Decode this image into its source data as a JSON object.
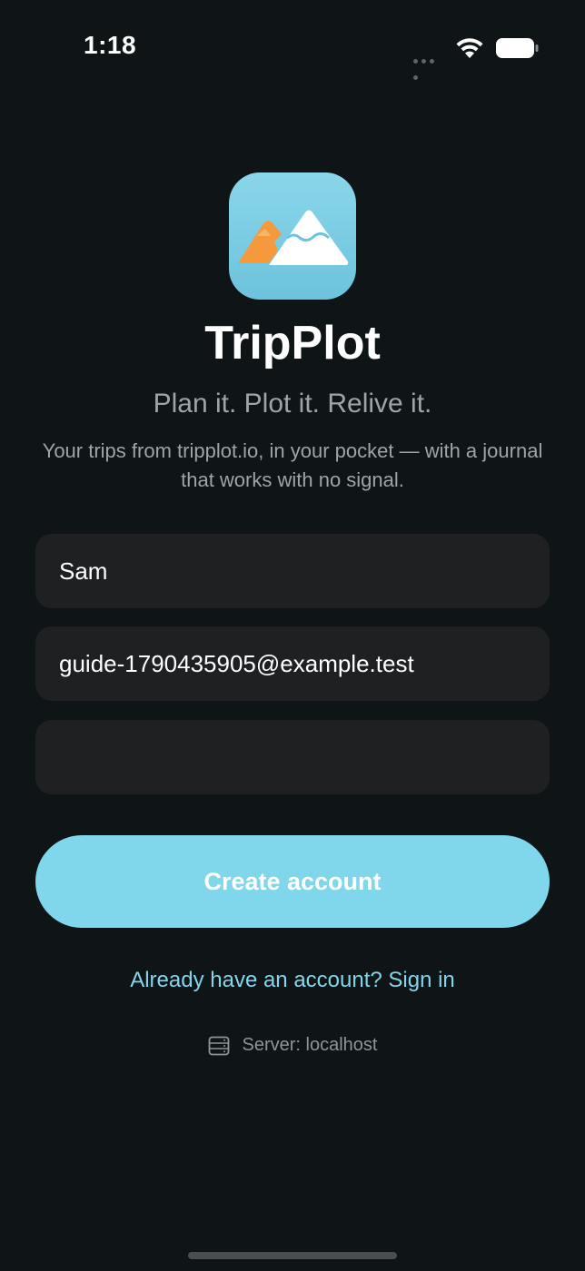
{
  "status_bar": {
    "time": "1:18"
  },
  "app": {
    "name": "TripPlot",
    "tagline": "Plan it. Plot it. Relive it.",
    "description": "Your trips from tripplot.io, in your pocket — with a journal that works with no signal."
  },
  "form": {
    "name_value": "Sam",
    "email_value": "guide-1790435905@example.test",
    "password_value": "",
    "submit_label": "Create account"
  },
  "signin_link": "Already have an account? Sign in",
  "server_label": "Server: localhost",
  "colors": {
    "background": "#0f1416",
    "accent": "#80d6ea",
    "field_background": "#1f2022",
    "icon_orange": "#f59a3c"
  },
  "icons": {
    "app_icon": "mountain-logo-icon",
    "wifi": "wifi-icon",
    "battery": "battery-icon",
    "server": "server-icon"
  }
}
